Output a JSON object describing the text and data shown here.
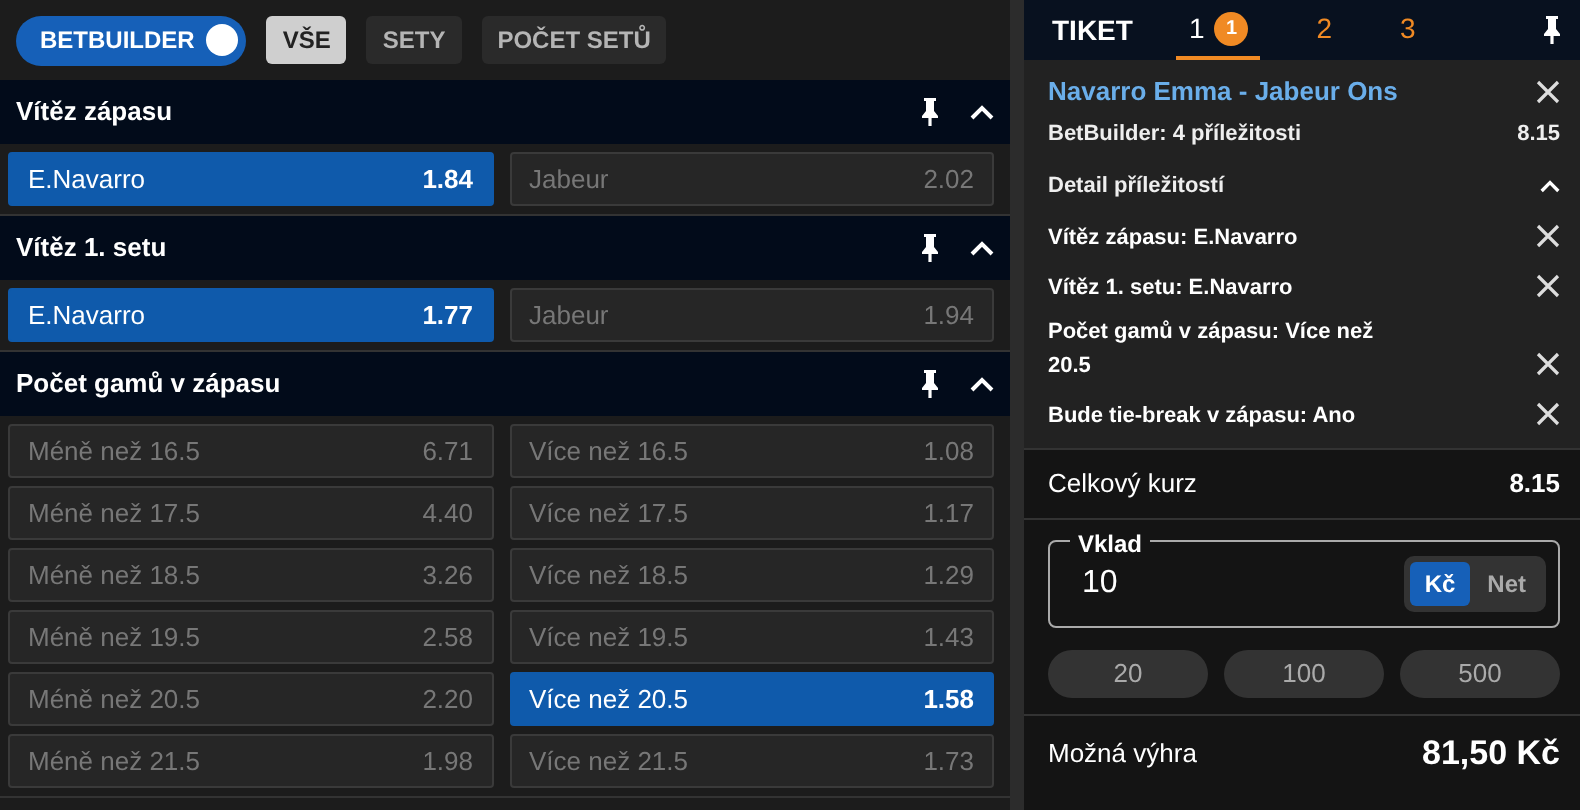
{
  "toolbar": {
    "toggle": {
      "label": "BETBUILDER",
      "on": true
    },
    "filters": [
      {
        "label": "VŠE",
        "selected": true
      },
      {
        "label": "SETY",
        "selected": false
      },
      {
        "label": "POČET SETŮ",
        "selected": false
      }
    ]
  },
  "markets": [
    {
      "title": "Vítěz zápasu",
      "expanded": true,
      "options": [
        {
          "label": "E.Navarro",
          "odds": "1.84",
          "selected": true
        },
        {
          "label": "Jabeur",
          "odds": "2.02",
          "selected": false
        }
      ]
    },
    {
      "title": "Vítěz 1. setu",
      "expanded": true,
      "options": [
        {
          "label": "E.Navarro",
          "odds": "1.77",
          "selected": true
        },
        {
          "label": "Jabeur",
          "odds": "1.94",
          "selected": false
        }
      ]
    },
    {
      "title": "Počet gamů v zápasu",
      "expanded": true,
      "options": [
        {
          "label": "Méně než 16.5",
          "odds": "6.71",
          "selected": false
        },
        {
          "label": "Více než 16.5",
          "odds": "1.08",
          "selected": false
        },
        {
          "label": "Méně než 17.5",
          "odds": "4.40",
          "selected": false
        },
        {
          "label": "Více než 17.5",
          "odds": "1.17",
          "selected": false
        },
        {
          "label": "Méně než 18.5",
          "odds": "3.26",
          "selected": false
        },
        {
          "label": "Více než 18.5",
          "odds": "1.29",
          "selected": false
        },
        {
          "label": "Méně než 19.5",
          "odds": "2.58",
          "selected": false
        },
        {
          "label": "Více než 19.5",
          "odds": "1.43",
          "selected": false
        },
        {
          "label": "Méně než 20.5",
          "odds": "2.20",
          "selected": false
        },
        {
          "label": "Více než 20.5",
          "odds": "1.58",
          "selected": true
        },
        {
          "label": "Méně než 21.5",
          "odds": "1.98",
          "selected": false
        },
        {
          "label": "Více než 21.5",
          "odds": "1.73",
          "selected": false
        }
      ]
    }
  ],
  "ticket": {
    "title": "TIKET",
    "tabs": [
      {
        "label": "1",
        "badge": "1",
        "selected": true
      },
      {
        "label": "2",
        "selected": false
      },
      {
        "label": "3",
        "selected": false
      }
    ],
    "event": "Navarro Emma - Jabeur Ons",
    "bet_type": "BetBuilder: 4 příležitosti",
    "bet_odds": "8.15",
    "detail": {
      "title": "Detail příležitostí",
      "expanded": true
    },
    "selections": [
      "Vítěz zápasu: E.Navarro",
      "Vítěz 1. setu: E.Navarro",
      "Počet gamů v zápasu: Více než 20.5",
      "Bude tie-break v zápasu: Ano"
    ],
    "total_label": "Celkový kurz",
    "total_odds": "8.15",
    "stake": {
      "label": "Vklad",
      "value": "10",
      "currencies": [
        {
          "label": "Kč",
          "selected": true
        },
        {
          "label": "Net",
          "selected": false
        }
      ]
    },
    "quick_stakes": [
      "20",
      "100",
      "500"
    ],
    "win_label": "Možná výhra",
    "win_value": "81,50 Kč"
  }
}
